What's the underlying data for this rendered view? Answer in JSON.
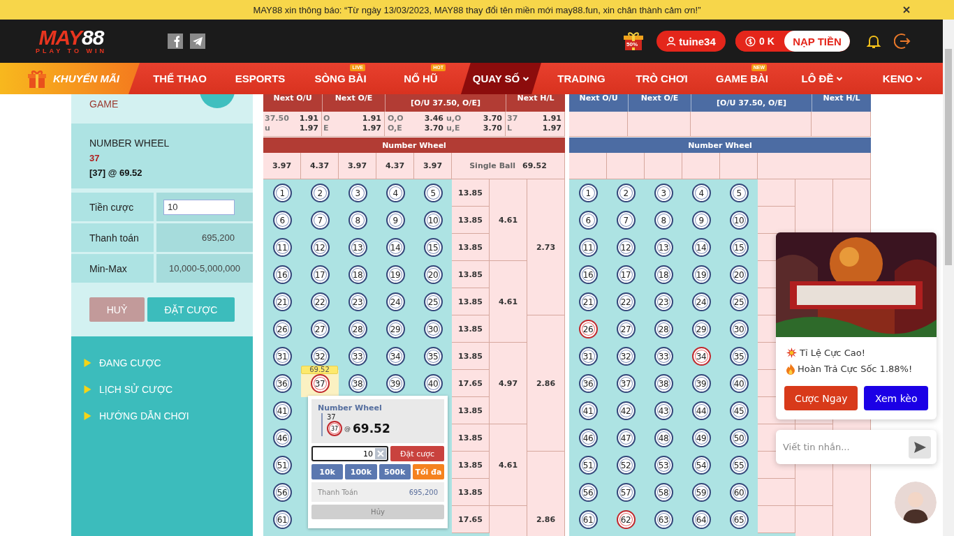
{
  "notice": {
    "text": "MAY88 xin thông báo: “Từ ngày 13/03/2023, MAY88 thay đổi tên miền mới may88.fun, xin chân thành cảm ơn!”"
  },
  "header": {
    "logo": {
      "name_parts": [
        "MAY",
        "88"
      ],
      "tagline": "PLAY TO WIN"
    },
    "socials": [
      {
        "kind": "facebook"
      },
      {
        "kind": "telegram"
      }
    ],
    "promo_badge": "50%",
    "user": "tuine34",
    "balance": "0 K",
    "deposit": "NẠP TIỀN"
  },
  "nav": {
    "promo": "KHUYẾN MÃI",
    "items": [
      {
        "label": "THỂ THAO",
        "selected": false,
        "dropdown": false
      },
      {
        "label": "ESPORTS",
        "selected": false,
        "dropdown": false
      },
      {
        "label": "SÒNG BÀI",
        "selected": false,
        "dropdown": false,
        "badge": "LIVE"
      },
      {
        "label": "NỔ HŨ",
        "selected": false,
        "dropdown": false,
        "badge": "HOT"
      },
      {
        "label": "QUAY SỐ",
        "selected": true,
        "dropdown": true
      },
      {
        "label": "TRADING",
        "selected": false,
        "dropdown": false
      },
      {
        "label": "TRÒ CHƠI",
        "selected": false,
        "dropdown": false
      },
      {
        "label": "GAME BÀI",
        "selected": false,
        "dropdown": false,
        "badge": "NEW"
      },
      {
        "label": "LÔ ĐỀ",
        "selected": false,
        "dropdown": true
      },
      {
        "label": "KENO",
        "selected": false,
        "dropdown": true
      }
    ]
  },
  "bet_slip": {
    "game_label": "GAME",
    "market": "NUMBER WHEEL",
    "pick": "37",
    "selection": "[37] @ 69.52",
    "rows": [
      {
        "label": "Tiền cược",
        "kind": "input",
        "value": "10"
      },
      {
        "label": "Thanh toán",
        "kind": "text",
        "value": "695,200"
      },
      {
        "label": "Min-Max",
        "kind": "text",
        "value": "10,000-5,000,000"
      }
    ],
    "cancel": "HUỶ",
    "submit": "ĐẶT CƯỢC"
  },
  "side_menu": [
    "ĐANG CƯỢC",
    "LỊCH SỬ CƯỢC",
    "HƯỚNG DẪN CHƠI"
  ],
  "boards": [
    {
      "color": "#b23c34",
      "headers": [
        "Next O/U",
        "Next O/E",
        "[O/U 37.50, O/E]",
        "Next H/L"
      ],
      "markets": [
        {
          "lines": [
            [
              "37.50",
              "1.91"
            ],
            [
              "u",
              "1.97"
            ]
          ]
        },
        {
          "lines": [
            [
              "O",
              "1.91"
            ],
            [
              "E",
              "1.97"
            ]
          ]
        },
        {
          "lines": [
            [
              "O,O",
              "3.46",
              "u,O",
              "3.70"
            ],
            [
              "O,E",
              "3.70",
              "u,E",
              "3.70"
            ]
          ]
        },
        {
          "lines": [
            [
              "37",
              "1.91"
            ],
            [
              "L",
              "1.97"
            ]
          ]
        }
      ],
      "section": "Number Wheel",
      "wheel_odds": [
        "3.97",
        "4.37",
        "3.97",
        "4.37",
        "3.97"
      ],
      "single_ball": {
        "label": "Single Ball",
        "value": "69.52"
      },
      "rows": [
        {
          "odds": "13.85",
          "balls": [
            {
              "n": "1",
              "hit": false,
              "selected": false
            },
            {
              "n": "2",
              "hit": false,
              "selected": false
            },
            {
              "n": "3",
              "hit": false,
              "selected": false
            },
            {
              "n": "4",
              "hit": false,
              "selected": false
            },
            {
              "n": "5",
              "hit": false,
              "selected": false
            }
          ]
        },
        {
          "odds": "13.85",
          "balls": [
            {
              "n": "6",
              "hit": false,
              "selected": false
            },
            {
              "n": "7",
              "hit": false,
              "selected": false
            },
            {
              "n": "8",
              "hit": false,
              "selected": false
            },
            {
              "n": "9",
              "hit": false,
              "selected": false
            },
            {
              "n": "10",
              "hit": false,
              "selected": false
            }
          ]
        },
        {
          "odds": "13.85",
          "balls": [
            {
              "n": "11",
              "hit": false,
              "selected": false
            },
            {
              "n": "12",
              "hit": false,
              "selected": false
            },
            {
              "n": "13",
              "hit": false,
              "selected": false
            },
            {
              "n": "14",
              "hit": false,
              "selected": false
            },
            {
              "n": "15",
              "hit": false,
              "selected": false
            }
          ]
        },
        {
          "odds": "13.85",
          "balls": [
            {
              "n": "16",
              "hit": false,
              "selected": false
            },
            {
              "n": "17",
              "hit": false,
              "selected": false
            },
            {
              "n": "18",
              "hit": false,
              "selected": false
            },
            {
              "n": "19",
              "hit": false,
              "selected": false
            },
            {
              "n": "20",
              "hit": false,
              "selected": false
            }
          ]
        },
        {
          "odds": "13.85",
          "balls": [
            {
              "n": "21",
              "hit": false,
              "selected": false
            },
            {
              "n": "22",
              "hit": false,
              "selected": false
            },
            {
              "n": "23",
              "hit": false,
              "selected": false
            },
            {
              "n": "24",
              "hit": false,
              "selected": false
            },
            {
              "n": "25",
              "hit": false,
              "selected": false
            }
          ]
        },
        {
          "odds": "13.85",
          "balls": [
            {
              "n": "26",
              "hit": false,
              "selected": false
            },
            {
              "n": "27",
              "hit": false,
              "selected": false
            },
            {
              "n": "28",
              "hit": false,
              "selected": false
            },
            {
              "n": "29",
              "hit": false,
              "selected": false
            },
            {
              "n": "30",
              "hit": false,
              "selected": false
            }
          ]
        },
        {
          "odds": "13.85",
          "balls": [
            {
              "n": "31",
              "hit": false,
              "selected": false
            },
            {
              "n": "32",
              "hit": false,
              "selected": false
            },
            {
              "n": "33",
              "hit": false,
              "selected": false
            },
            {
              "n": "34",
              "hit": false,
              "selected": false
            },
            {
              "n": "35",
              "hit": false,
              "selected": false
            }
          ]
        },
        {
          "odds": "17.65",
          "balls": [
            {
              "n": "36",
              "hit": false,
              "selected": false
            },
            {
              "n": "37",
              "hit": false,
              "selected": true
            },
            {
              "n": "38",
              "hit": false,
              "selected": false
            },
            {
              "n": "39",
              "hit": false,
              "selected": false
            },
            {
              "n": "40",
              "hit": false,
              "selected": false
            }
          ]
        },
        {
          "odds": "13.85",
          "balls": [
            {
              "n": "41",
              "hit": false,
              "selected": false
            }
          ]
        },
        {
          "odds": "13.85",
          "balls": [
            {
              "n": "46",
              "hit": false,
              "selected": false
            }
          ]
        },
        {
          "odds": "13.85",
          "balls": [
            {
              "n": "51",
              "hit": false,
              "selected": false
            }
          ]
        },
        {
          "odds": "13.85",
          "balls": [
            {
              "n": "56",
              "hit": false,
              "selected": false
            }
          ]
        },
        {
          "odds": "17.65",
          "balls": [
            {
              "n": "61",
              "hit": false,
              "selected": false
            }
          ]
        }
      ],
      "group_odds": [
        "4.61",
        "4.61",
        "4.97",
        "4.61"
      ],
      "band_odds": [
        "2.73",
        "2.86",
        "2.86"
      ],
      "tooltip": "69.52",
      "popup": {
        "market": "Number Wheel",
        "pick": "37",
        "ball": "37",
        "at": "@",
        "price": "69.52",
        "stake": "10",
        "place": "Đặt cược",
        "chips": [
          {
            "label": "10k",
            "kind": "chip"
          },
          {
            "label": "100k",
            "kind": "chip"
          },
          {
            "label": "500k",
            "kind": "chip"
          },
          {
            "label": "Tối đa",
            "kind": "max"
          }
        ],
        "payout_label": "Thanh Toán",
        "payout": "695,200",
        "cancel": "Hủy"
      }
    },
    {
      "color": "#4c6ca3",
      "headers": [
        "Next O/U",
        "Next O/E",
        "[O/U 37.50, O/E]",
        "Next H/L"
      ],
      "section": "Number Wheel",
      "rows": [
        {
          "balls": [
            {
              "n": "1",
              "hit": false,
              "selected": false
            },
            {
              "n": "2",
              "hit": false,
              "selected": false
            },
            {
              "n": "3",
              "hit": false,
              "selected": false
            },
            {
              "n": "4",
              "hit": false,
              "selected": false
            },
            {
              "n": "5",
              "hit": false,
              "selected": false
            }
          ]
        },
        {
          "balls": [
            {
              "n": "6",
              "hit": false,
              "selected": false
            },
            {
              "n": "7",
              "hit": false,
              "selected": false
            },
            {
              "n": "8",
              "hit": false,
              "selected": false
            },
            {
              "n": "9",
              "hit": false,
              "selected": false
            },
            {
              "n": "10",
              "hit": false,
              "selected": false
            }
          ]
        },
        {
          "balls": [
            {
              "n": "11",
              "hit": false,
              "selected": false
            },
            {
              "n": "12",
              "hit": false,
              "selected": false
            },
            {
              "n": "13",
              "hit": false,
              "selected": false
            },
            {
              "n": "14",
              "hit": false,
              "selected": false
            },
            {
              "n": "15",
              "hit": false,
              "selected": false
            }
          ]
        },
        {
          "balls": [
            {
              "n": "16",
              "hit": false,
              "selected": false
            },
            {
              "n": "17",
              "hit": false,
              "selected": false
            },
            {
              "n": "18",
              "hit": false,
              "selected": false
            },
            {
              "n": "19",
              "hit": false,
              "selected": false
            },
            {
              "n": "20",
              "hit": false,
              "selected": false
            }
          ]
        },
        {
          "balls": [
            {
              "n": "21",
              "hit": false,
              "selected": false
            },
            {
              "n": "22",
              "hit": false,
              "selected": false
            },
            {
              "n": "23",
              "hit": false,
              "selected": false
            },
            {
              "n": "24",
              "hit": false,
              "selected": false
            },
            {
              "n": "25",
              "hit": false,
              "selected": false
            }
          ]
        },
        {
          "balls": [
            {
              "n": "26",
              "hit": true,
              "selected": false
            },
            {
              "n": "27",
              "hit": false,
              "selected": false
            },
            {
              "n": "28",
              "hit": false,
              "selected": false
            },
            {
              "n": "29",
              "hit": false,
              "selected": false
            },
            {
              "n": "30",
              "hit": false,
              "selected": false
            }
          ]
        },
        {
          "balls": [
            {
              "n": "31",
              "hit": false,
              "selected": false
            },
            {
              "n": "32",
              "hit": false,
              "selected": false
            },
            {
              "n": "33",
              "hit": false,
              "selected": false
            },
            {
              "n": "34",
              "hit": true,
              "selected": false
            },
            {
              "n": "35",
              "hit": false,
              "selected": false
            }
          ]
        },
        {
          "balls": [
            {
              "n": "36",
              "hit": false,
              "selected": false
            },
            {
              "n": "37",
              "hit": false,
              "selected": false
            },
            {
              "n": "38",
              "hit": false,
              "selected": false
            },
            {
              "n": "39",
              "hit": false,
              "selected": false
            },
            {
              "n": "40",
              "hit": false,
              "selected": false
            }
          ]
        },
        {
          "balls": [
            {
              "n": "41",
              "hit": false,
              "selected": false
            },
            {
              "n": "42",
              "hit": false,
              "selected": false
            },
            {
              "n": "43",
              "hit": false,
              "selected": false
            },
            {
              "n": "44",
              "hit": false,
              "selected": false
            },
            {
              "n": "45",
              "hit": false,
              "selected": false
            }
          ]
        },
        {
          "balls": [
            {
              "n": "46",
              "hit": false,
              "selected": false
            },
            {
              "n": "47",
              "hit": false,
              "selected": false
            },
            {
              "n": "48",
              "hit": false,
              "selected": false
            },
            {
              "n": "49",
              "hit": false,
              "selected": false
            },
            {
              "n": "50",
              "hit": false,
              "selected": false
            }
          ]
        },
        {
          "balls": [
            {
              "n": "51",
              "hit": false,
              "selected": false
            },
            {
              "n": "52",
              "hit": false,
              "selected": false
            },
            {
              "n": "53",
              "hit": false,
              "selected": false
            },
            {
              "n": "54",
              "hit": false,
              "selected": false
            },
            {
              "n": "55",
              "hit": false,
              "selected": false
            }
          ]
        },
        {
          "balls": [
            {
              "n": "56",
              "hit": false,
              "selected": false
            },
            {
              "n": "57",
              "hit": false,
              "selected": false
            },
            {
              "n": "58",
              "hit": false,
              "selected": false
            },
            {
              "n": "59",
              "hit": false,
              "selected": false
            },
            {
              "n": "60",
              "hit": false,
              "selected": false
            }
          ]
        },
        {
          "balls": [
            {
              "n": "61",
              "hit": false,
              "selected": false
            },
            {
              "n": "62",
              "hit": true,
              "selected": false
            },
            {
              "n": "63",
              "hit": false,
              "selected": false
            },
            {
              "n": "64",
              "hit": false,
              "selected": false
            },
            {
              "n": "65",
              "hit": false,
              "selected": false
            }
          ]
        }
      ]
    }
  ],
  "promo": {
    "lines": [
      {
        "kind": "burst",
        "text": "Tỉ Lệ Cực Cao!"
      },
      {
        "kind": "flame",
        "text": "Hoàn Trả Cực Sốc 1.88%!"
      }
    ],
    "buttons": [
      {
        "label": "Cược Ngay",
        "kind": "primary"
      },
      {
        "label": "Xem kèo",
        "kind": "secondary"
      }
    ]
  },
  "chat": {
    "placeholder": "Viết tin nhắn..."
  }
}
